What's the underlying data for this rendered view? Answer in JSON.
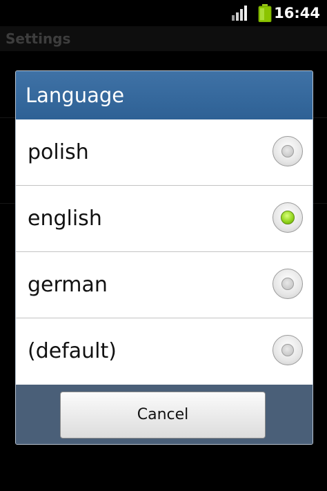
{
  "status_bar": {
    "time": "16:44",
    "signal_icon": "signal-bars-icon",
    "battery_icon": "battery-icon",
    "battery_color": "#8bc400"
  },
  "background_app": {
    "title": "Settings"
  },
  "dialog": {
    "title": "Language",
    "header_color": "#336699",
    "options": [
      {
        "label": "polish",
        "checked": false
      },
      {
        "label": "english",
        "checked": true
      },
      {
        "label": "german",
        "checked": false
      },
      {
        "label": "(default)",
        "checked": false
      }
    ],
    "cancel_label": "Cancel"
  }
}
